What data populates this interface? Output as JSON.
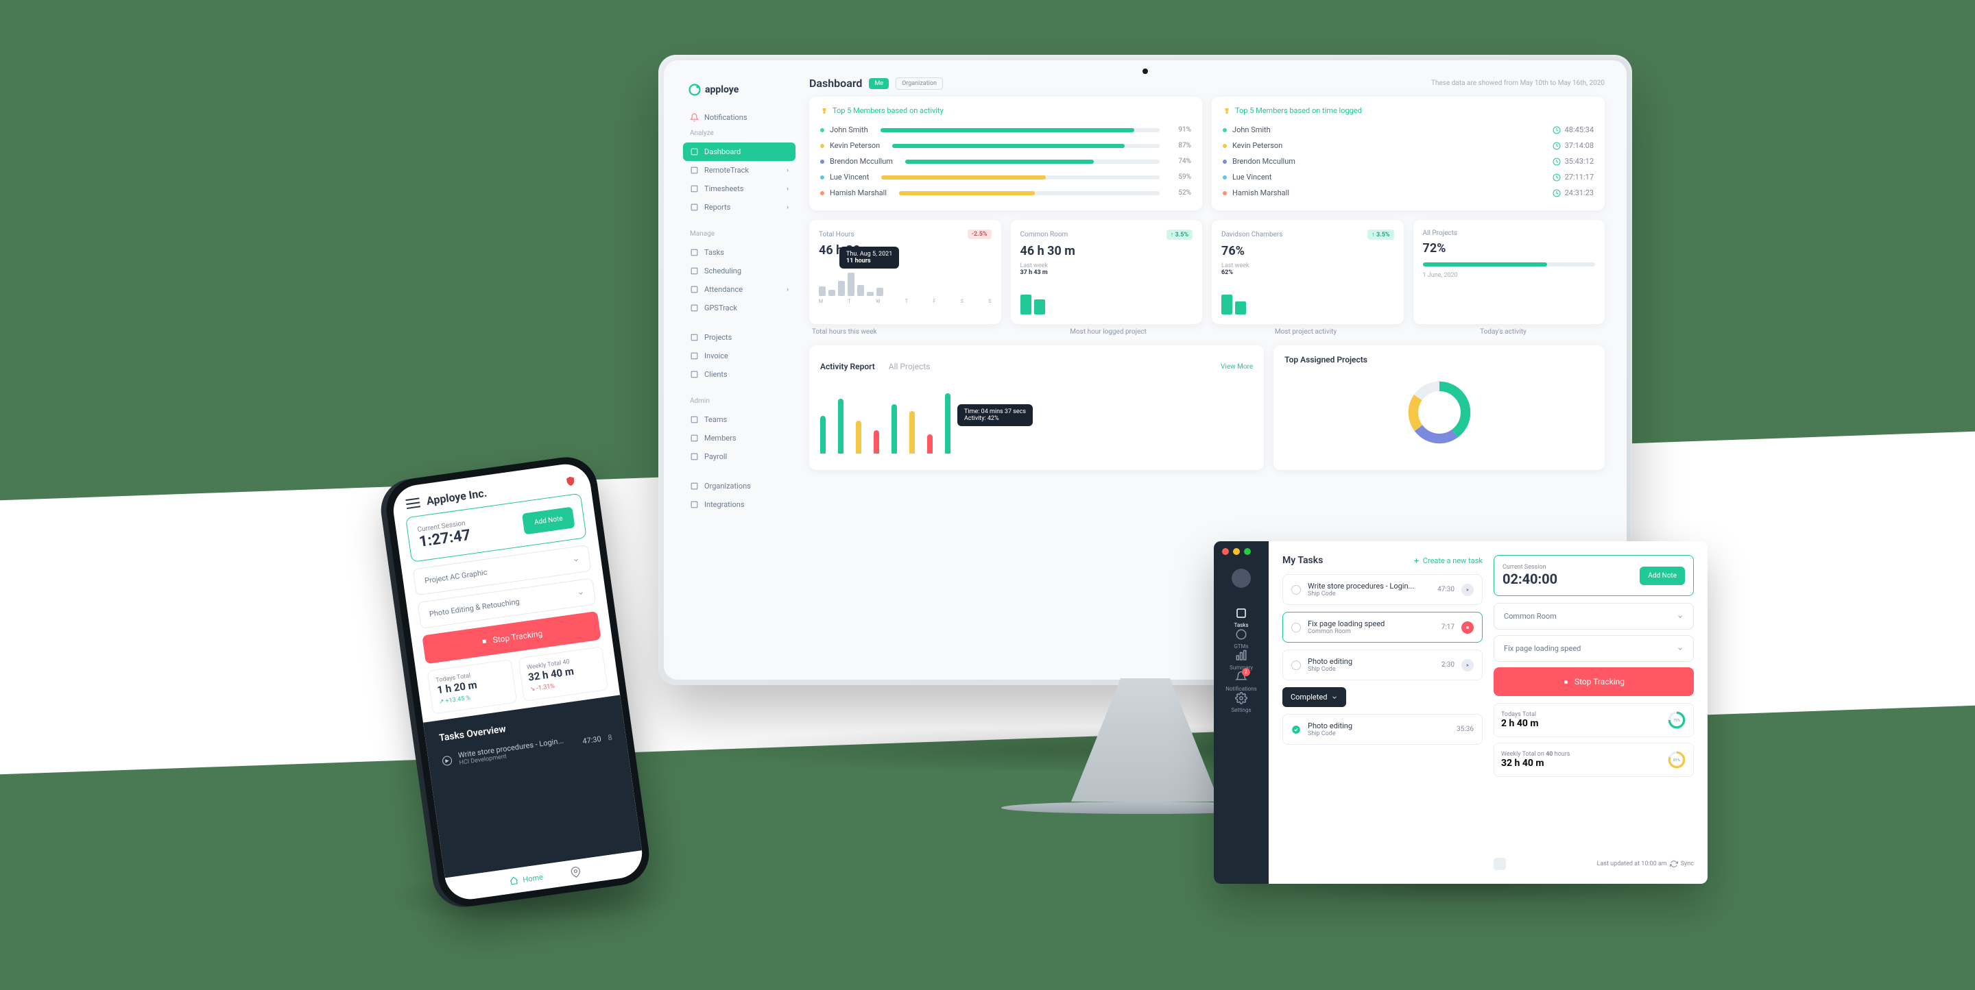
{
  "brand": "apploye",
  "desktop": {
    "page_title": "Dashboard",
    "tab_me": "Me",
    "tab_org": "Organization",
    "date_note": "These data are showed from May 10th to May 16th, 2020",
    "sidebar": {
      "notifications": "Notifications",
      "sections": [
        {
          "heading": "Analyze",
          "items": [
            {
              "label": "Dashboard",
              "active": true
            },
            {
              "label": "RemoteTrack",
              "chev": true
            },
            {
              "label": "Timesheets",
              "chev": true
            },
            {
              "label": "Reports",
              "chev": true
            }
          ]
        },
        {
          "heading": "Manage",
          "items": [
            {
              "label": "Tasks"
            },
            {
              "label": "Scheduling"
            },
            {
              "label": "Attendance",
              "chev": true
            },
            {
              "label": "GPSTrack"
            }
          ]
        },
        {
          "heading": "",
          "items": [
            {
              "label": "Projects"
            },
            {
              "label": "Invoice"
            },
            {
              "label": "Clients"
            }
          ]
        },
        {
          "heading": "Admin",
          "items": [
            {
              "label": "Teams"
            },
            {
              "label": "Members"
            },
            {
              "label": "Payroll"
            }
          ]
        },
        {
          "heading": "",
          "items": [
            {
              "label": "Organizations"
            },
            {
              "label": "Integrations"
            }
          ]
        }
      ]
    },
    "top5_activity": {
      "title": "Top 5 Members based on activity",
      "rows": [
        {
          "name": "John Smith",
          "pct": 91,
          "color": "#20c997"
        },
        {
          "name": "Kevin Peterson",
          "pct": 87,
          "color": "#20c997"
        },
        {
          "name": "Brendon Mccullum",
          "pct": 74,
          "color": "#20c997"
        },
        {
          "name": "Lue Vincent",
          "pct": 59,
          "color": "#f6c646"
        },
        {
          "name": "Hamish Marshall",
          "pct": 52,
          "color": "#f6c646"
        }
      ]
    },
    "top5_time": {
      "title": "Top 5 Members based on time logged",
      "rows": [
        {
          "name": "John Smith",
          "time": "48:45:34"
        },
        {
          "name": "Kevin Peterson",
          "time": "37:14:08"
        },
        {
          "name": "Brendon Mccullum",
          "time": "35:43:12"
        },
        {
          "name": "Lue Vincent",
          "time": "27:11:17"
        },
        {
          "name": "Hamish Marshall",
          "time": "24:31:23"
        }
      ]
    },
    "stats": [
      {
        "label": "Total Hours",
        "value": "46 h 30 m",
        "badge": "-2.5%",
        "badge_red": true,
        "bars": [
          30,
          18,
          45,
          70,
          34,
          12,
          26
        ],
        "axis": [
          "M",
          "T",
          "W",
          "T",
          "F",
          "S",
          "S"
        ],
        "tooltip": {
          "l1": "Thu. Aug 5, 2021",
          "l2": "11 hours"
        },
        "caption": "Total hours this week"
      },
      {
        "label": "Common Room",
        "value": "46 h 30 m",
        "badge": "↑ 3.5%",
        "sub_l": "Last week",
        "sub_v": "37 h 43 m",
        "bars": [
          60,
          45
        ],
        "caption": "Most hour logged project"
      },
      {
        "label": "Davidson Chambers",
        "value": "76%",
        "badge": "↑ 3.5%",
        "sub_l": "Last week",
        "sub_v": "62%",
        "bars": [
          60,
          40
        ],
        "caption": "Most project activity"
      },
      {
        "label": "All Projects",
        "value": "72%",
        "progress": 72,
        "sub_v": "1 June, 2020",
        "caption": "Today's activity"
      }
    ],
    "activity_report": {
      "title": "Activity Report",
      "sub": "All Projects",
      "view_more": "View More",
      "bars": [
        {
          "h": 55,
          "c": "#20c997"
        },
        {
          "h": 80,
          "c": "#20c997"
        },
        {
          "h": 48,
          "c": "#f6c646"
        },
        {
          "h": 34,
          "c": "#ff5764"
        },
        {
          "h": 72,
          "c": "#20c997"
        },
        {
          "h": 62,
          "c": "#f6c646"
        },
        {
          "h": 28,
          "c": "#ff5764"
        },
        {
          "h": 88,
          "c": "#20c997"
        }
      ],
      "tooltip": {
        "l1": "Time: 04 mins 37 secs",
        "l2": "Activity: 42%"
      }
    },
    "top_assigned": {
      "title": "Top Assigned Projects"
    }
  },
  "phone": {
    "brand": "Apploye Inc.",
    "session": {
      "label": "Current Session",
      "time": "1:27:47",
      "action": "Add Note"
    },
    "project_select": "Project AC Graphic",
    "task_select": "Photo Editing & Retouching",
    "stop": "Stop Tracking",
    "today": {
      "label": "Todays Total",
      "value": "1 h 20 m",
      "change": "+13.45 %"
    },
    "weekly": {
      "label": "Weekly Total",
      "target": "40",
      "value": "32 h 40 m",
      "change": "-1.31%"
    },
    "tasks_overview": "Tasks Overview",
    "task": {
      "title": "Write store procedures - Login...",
      "sub": "HCI Development",
      "time": "47:30",
      "count": "8"
    },
    "nav_home": "Home"
  },
  "widget": {
    "my_tasks": "My Tasks",
    "create": "Create a new task",
    "tasks": [
      {
        "title": "Write store procedures - Login...",
        "sub": "Ship Code",
        "time": "47:30",
        "play": "grey"
      },
      {
        "title": "Fix page loading speed",
        "sub": "Common Room",
        "time": "7:17",
        "active": true,
        "play": "stop"
      },
      {
        "title": "Photo editing",
        "sub": "Ship Code",
        "time": "2:30",
        "play": "grey"
      }
    ],
    "completed_label": "Completed",
    "completed_task": {
      "title": "Photo editing",
      "sub": "Ship Code",
      "time": "35:36"
    },
    "session": {
      "label": "Current Session",
      "time": "02:40:00",
      "action": "Add Note"
    },
    "project_select": "Common Room",
    "task_select": "Fix page loading speed",
    "stop": "Stop Tracking",
    "today": {
      "label": "Todays Total",
      "value": "2 h 40 m",
      "pct": "75%"
    },
    "weekly": {
      "label": "Weekly Total",
      "target_pre": "on",
      "target": "40",
      "target_suf": "hours",
      "value": "32 h 40 m",
      "pct": "81%"
    },
    "footer": {
      "updated": "Last updated at 10:00 am",
      "sync": "Sync"
    },
    "nav": [
      "Tasks",
      "GTMs",
      "Summary",
      "Notifications",
      "Settings"
    ]
  },
  "dot_colors": [
    "#3dd6a9",
    "#f6c646",
    "#7a8adf",
    "#5ec6e8",
    "#ff8f6d"
  ]
}
